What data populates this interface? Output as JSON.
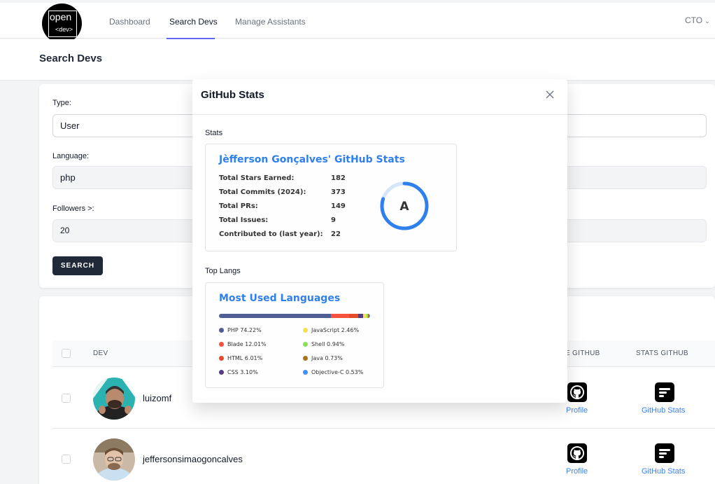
{
  "navbar": {
    "logo_top": "open",
    "logo_bottom": "<dev>",
    "links": [
      "Dashboard",
      "Search Devs",
      "Manage Assistants"
    ],
    "active": "Search Devs",
    "user": "CTO"
  },
  "header": {
    "title": "Search Devs"
  },
  "search": {
    "type_label": "Type:",
    "type_value": "User",
    "language_label": "Language:",
    "language_value": "php",
    "followers_label": "Followers >:",
    "followers_value": "20",
    "button": "SEARCH"
  },
  "table": {
    "headers": {
      "dev": "DEV",
      "profile": "E GITHUB",
      "stats": "STATS GITHUB"
    },
    "rows": [
      {
        "username": "luizomf",
        "profile_link": "Profile",
        "stats_link": "GitHub Stats"
      },
      {
        "username": "jeffersonsimaogoncalves",
        "profile_link": "Profile",
        "stats_link": "GitHub Stats"
      }
    ]
  },
  "modal": {
    "title": "GitHub Stats",
    "stats_section": "Stats",
    "langs_section": "Top Langs",
    "stats_card": {
      "title": "Jèfferson Gonçalves' GitHub Stats",
      "rows": [
        {
          "label": "Total Stars Earned:",
          "value": "182"
        },
        {
          "label": "Total Commits (2024):",
          "value": "373"
        },
        {
          "label": "Total PRs:",
          "value": "149"
        },
        {
          "label": "Total Issues:",
          "value": "9"
        },
        {
          "label": "Contributed to (last year):",
          "value": "22"
        }
      ],
      "rank": "A",
      "rank_progress": 0.8,
      "ring_color": "#2f80ed"
    },
    "langs_card": {
      "title": "Most Used Languages",
      "languages": [
        {
          "name": "PHP",
          "percent": 74.22,
          "label": "PHP 74.22%",
          "color": "#4F5D95"
        },
        {
          "name": "Blade",
          "percent": 12.01,
          "label": "Blade 12.01%",
          "color": "#f7523f"
        },
        {
          "name": "HTML",
          "percent": 6.01,
          "label": "HTML 6.01%",
          "color": "#e34c26"
        },
        {
          "name": "CSS",
          "percent": 3.1,
          "label": "CSS 3.10%",
          "color": "#563d7c"
        },
        {
          "name": "JavaScript",
          "percent": 2.46,
          "label": "JavaScript 2.46%",
          "color": "#f1e05a"
        },
        {
          "name": "Shell",
          "percent": 0.94,
          "label": "Shell 0.94%",
          "color": "#89e051"
        },
        {
          "name": "Java",
          "percent": 0.73,
          "label": "Java 0.73%",
          "color": "#b07219"
        },
        {
          "name": "Objective-C",
          "percent": 0.53,
          "label": "Objective-C 0.53%",
          "color": "#438eff"
        }
      ]
    }
  },
  "colors": {
    "accent": "#6366f1",
    "link": "#3b82f6",
    "button": "#1f2937",
    "card_title": "#2f80ed"
  },
  "icons": {
    "close": "close-icon",
    "github": "github-icon",
    "stats": "stats-icon",
    "dropdown": "chevron-down-icon"
  }
}
